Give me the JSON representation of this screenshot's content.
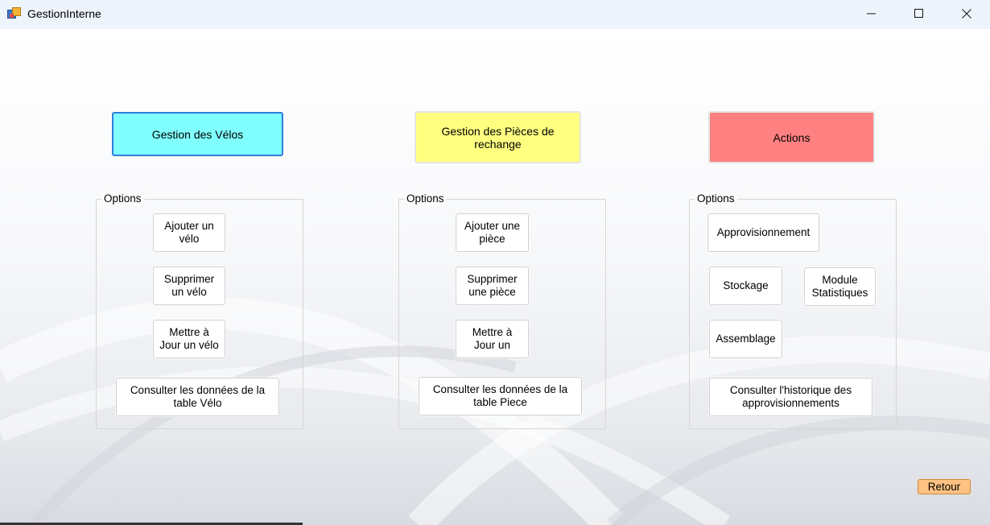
{
  "window": {
    "title": "GestionInterne",
    "controls": [
      "minimize-icon",
      "maximize-icon",
      "close-icon"
    ]
  },
  "headers": {
    "velos": {
      "label": "Gestion des Vélos",
      "color": "#80ffff"
    },
    "pieces": {
      "label": "Gestion des Pièces de\nrechange",
      "color": "#ffff80"
    },
    "actions": {
      "label": "Actions",
      "color": "#ff8080"
    }
  },
  "groups": {
    "velos": {
      "legend": "Options",
      "buttons": [
        "Ajouter un\nvélo",
        "Supprimer\nun vélo",
        "Mettre à\nJour un vélo",
        "Consulter les données de la\ntable Vélo"
      ]
    },
    "pieces": {
      "legend": "Options",
      "buttons": [
        "Ajouter une\npièce",
        "Supprimer\nune pièce",
        "Mettre à\nJour un",
        "Consulter les données de la\ntable Piece"
      ]
    },
    "actions": {
      "legend": "Options",
      "buttons": [
        "Approvisionnement",
        "Stockage",
        "Module\nStatistiques",
        "Assemblage",
        "Consulter l'historique des\napprovisionnements"
      ]
    }
  },
  "retour": {
    "label": "Retour",
    "color": "#ffc282"
  }
}
